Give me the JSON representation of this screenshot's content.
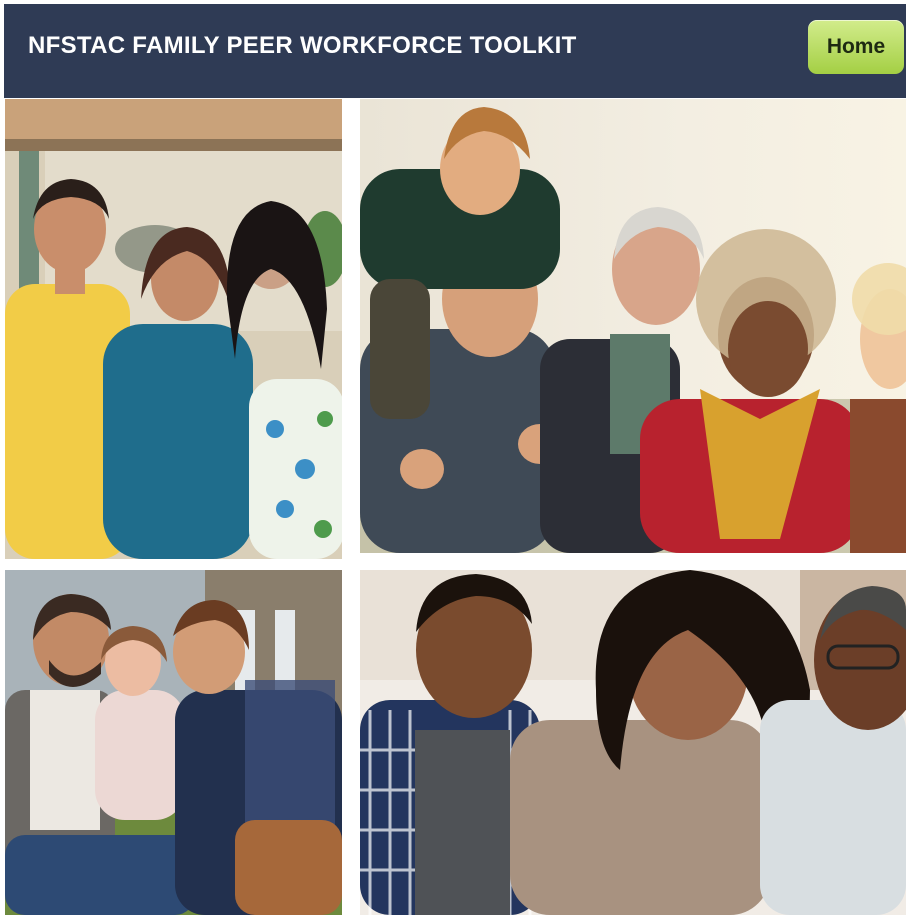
{
  "header": {
    "title": "NFSTAC FAMILY PEER WORKFORCE TOOLKIT",
    "home_label": "Home",
    "background": "#2f3b55",
    "button_color": "#b5db5f"
  },
  "photos": [
    {
      "name": "family-photo-three-adults"
    },
    {
      "name": "family-photo-multigenerational-outdoors"
    },
    {
      "name": "family-photo-two-fathers-with-daughter"
    },
    {
      "name": "family-photo-teens-with-grandfather"
    }
  ]
}
